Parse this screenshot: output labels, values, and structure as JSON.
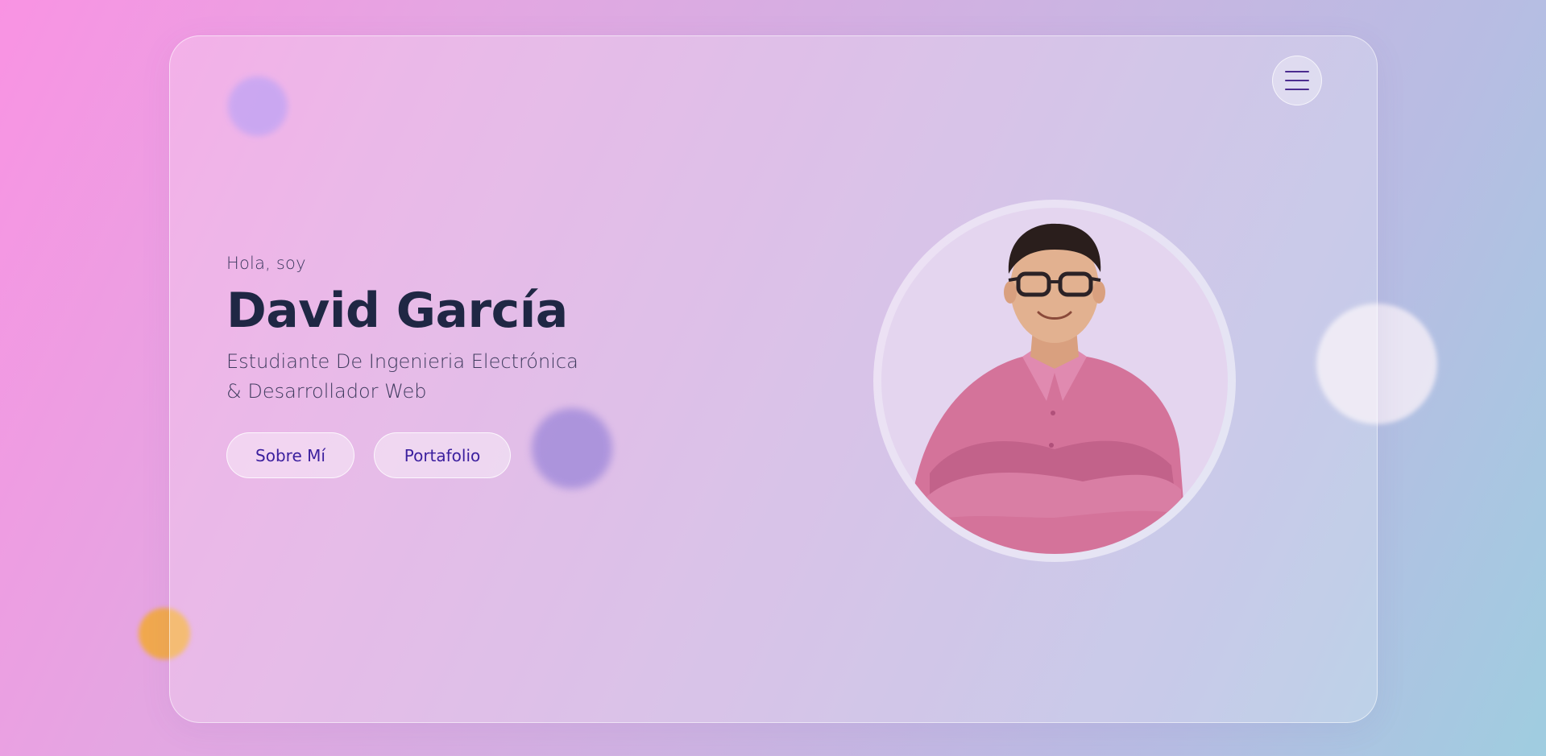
{
  "hero": {
    "greeting": "Hola, soy",
    "name": "David García",
    "role_line1": "Estudiante De Ingenieria Electrónica",
    "role_line2": "& Desarrollador Web"
  },
  "buttons": {
    "about_label": "Sobre Mí",
    "portfolio_label": "Portafolio"
  },
  "icons": {
    "menu": "hamburger-menu-icon"
  },
  "colors": {
    "accent": "#3b1f9e",
    "heading": "#1f2744",
    "gradient_start": "#f993e3",
    "gradient_end": "#9fcde0",
    "blob_orange": "#f1a94e",
    "blob_purple": "#b88ef0"
  }
}
